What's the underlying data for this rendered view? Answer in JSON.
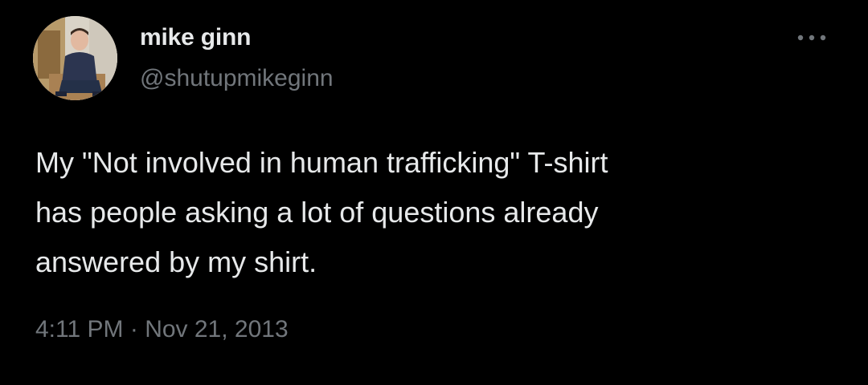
{
  "author": {
    "display_name": "mike ginn",
    "handle": "@shutupmikeginn",
    "avatar_icon": "profile-photo"
  },
  "more_icon": "more-horizontal-icon",
  "tweet": {
    "lines": [
      "My \"Not involved in human trafficking\" T-shirt",
      "has people asking a lot of questions already",
      "answered by my shirt."
    ],
    "time": "4:11 PM",
    "separator": "·",
    "date": "Nov 21, 2013"
  },
  "colors": {
    "background": "#000000",
    "primary_text": "#e7e9ea",
    "secondary_text": "#71767b"
  }
}
